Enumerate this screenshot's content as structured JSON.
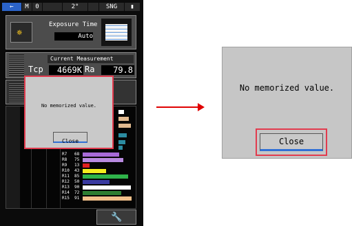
{
  "device": {
    "status_bar": {
      "mode": "M",
      "memory": "0",
      "angle": "2°",
      "measurement_mode": "SNG"
    },
    "exposure_time": {
      "label": "Exposure Time",
      "value": "Auto"
    },
    "current_measurement": {
      "title": "Current Measurement",
      "tcp_label": "Tcp",
      "tcp_value": "4669K",
      "ra_label": "Ra",
      "ra_value": "79.8"
    },
    "cri_rows": [
      {
        "label": "R7",
        "value": "68",
        "fraction": 0.68,
        "color": "#a76ad8"
      },
      {
        "label": "R8",
        "value": "75",
        "fraction": 0.75,
        "color": "#b98ae0"
      },
      {
        "label": "R9",
        "value": "13",
        "fraction": 0.13,
        "color": "#e02020"
      },
      {
        "label": "R10",
        "value": "43",
        "fraction": 0.43,
        "color": "#f5ee1e"
      },
      {
        "label": "R11",
        "value": "85",
        "fraction": 0.85,
        "color": "#2fb34a"
      },
      {
        "label": "R12",
        "value": "50",
        "fraction": 0.5,
        "color": "#3a3aa0"
      },
      {
        "label": "R13",
        "value": "90",
        "fraction": 0.9,
        "color": "#ffffff"
      },
      {
        "label": "R14",
        "value": "72",
        "fraction": 0.72,
        "color": "#2e7d32"
      },
      {
        "label": "R15",
        "value": "91",
        "fraction": 0.91,
        "color": "#f1c08a"
      }
    ],
    "modal": {
      "message": "No memorized value.",
      "close_label": "Close"
    }
  },
  "zoom": {
    "message": "No memorized value.",
    "close_label": "Close"
  },
  "colors": {
    "highlight": "#e23a4d",
    "arrow": "#e00000",
    "button_blue": "#2f6fd6"
  }
}
